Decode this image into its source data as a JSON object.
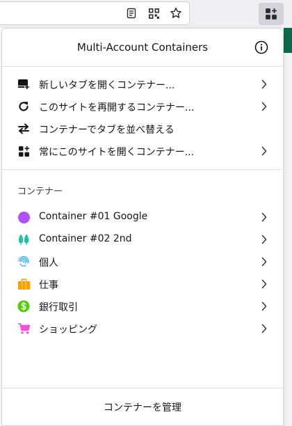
{
  "popup": {
    "title": "Multi-Account Containers"
  },
  "actions": [
    {
      "label": "新しいタブを開くコンテナー...",
      "icon": "new-tab-container-icon",
      "has_arrow": true
    },
    {
      "label": "このサイトを再開するコンテナー...",
      "icon": "reopen-icon",
      "has_arrow": true
    },
    {
      "label": "コンテナーでタブを並べ替える",
      "icon": "sort-tabs-icon",
      "has_arrow": false
    },
    {
      "label": "常にこのサイトを開くコンテナー...",
      "icon": "always-open-icon",
      "has_arrow": true
    }
  ],
  "containers_section": {
    "header": "コンテナー",
    "items": [
      {
        "label": "Container #01 Google",
        "icon": "circle-icon",
        "color": "#af51f5"
      },
      {
        "label": "Container #02 2nd",
        "icon": "tree-icon",
        "color": "#37adff"
      },
      {
        "label": "個人",
        "icon": "fingerprint-icon",
        "color": "#37adff"
      },
      {
        "label": "仕事",
        "icon": "briefcase-icon",
        "color": "#ff9f00"
      },
      {
        "label": "銀行取引",
        "icon": "dollar-icon",
        "color": "#51cd00"
      },
      {
        "label": "ショッピング",
        "icon": "cart-icon",
        "color": "#ff4bda"
      }
    ]
  },
  "footer": {
    "manage_label": "コンテナーを管理"
  },
  "colors": {
    "panel_border": "#d7d7db",
    "divider": "#e0e0e6",
    "text": "#15141a",
    "toolbar_button_active": "#d3d3d9",
    "page_header_green": "#0b6b4b"
  }
}
